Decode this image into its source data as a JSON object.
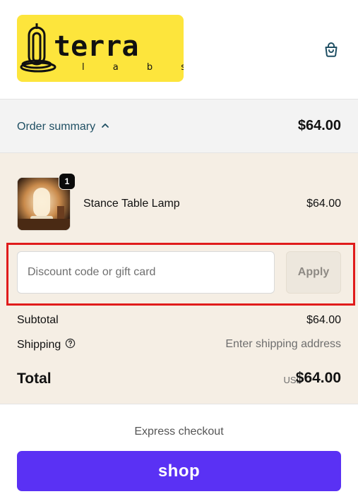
{
  "brand": {
    "logo_text": "terra",
    "logo_subtext": "l a b s",
    "logo_bg": "#fde53c",
    "icon": "cart-bag-icon"
  },
  "summary": {
    "toggle_label": "Order summary",
    "toggle_icon": "chevron-up-icon",
    "total": "$64.00"
  },
  "line_items": [
    {
      "name": "Stance Table Lamp",
      "price": "$64.00",
      "quantity": "1"
    }
  ],
  "discount": {
    "placeholder": "Discount code or gift card",
    "apply_label": "Apply"
  },
  "totals": {
    "subtotal_label": "Subtotal",
    "subtotal_value": "$64.00",
    "shipping_label": "Shipping",
    "shipping_icon": "help-circle-icon",
    "shipping_value": "Enter shipping address",
    "total_label": "Total",
    "currency": "USD",
    "total_value": "$64.00"
  },
  "express": {
    "label": "Express checkout",
    "shop_label": "shop",
    "shop_color": "#5a31f4"
  }
}
